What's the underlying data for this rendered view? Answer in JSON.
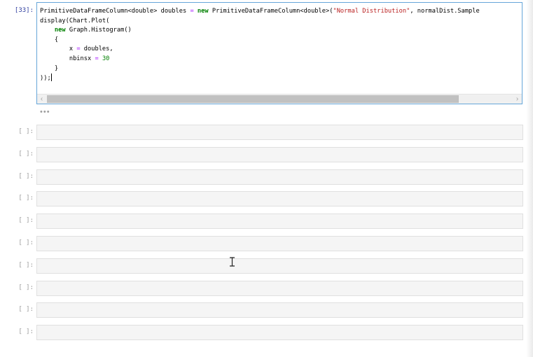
{
  "cells": {
    "active": {
      "prompt": "[33]:",
      "lines": [
        [
          {
            "t": "PrimitiveDataFrameColumn<double> doubles ",
            "c": ""
          },
          {
            "t": "=",
            "c": "op"
          },
          {
            "t": " ",
            "c": ""
          },
          {
            "t": "new",
            "c": "kw"
          },
          {
            "t": " PrimitiveDataFrameColumn<double>(",
            "c": ""
          },
          {
            "t": "\"Normal Distribution\"",
            "c": "str"
          },
          {
            "t": ", normalDist.Sample",
            "c": ""
          }
        ],
        [
          {
            "t": "display(Chart.Plot(",
            "c": ""
          }
        ],
        [
          {
            "t": "    ",
            "c": ""
          },
          {
            "t": "new",
            "c": "kw"
          },
          {
            "t": " Graph.Histogram()",
            "c": ""
          }
        ],
        [
          {
            "t": "    {",
            "c": ""
          }
        ],
        [
          {
            "t": "        x ",
            "c": ""
          },
          {
            "t": "=",
            "c": "op"
          },
          {
            "t": " doubles,",
            "c": ""
          }
        ],
        [
          {
            "t": "        nbinsx ",
            "c": ""
          },
          {
            "t": "=",
            "c": "op"
          },
          {
            "t": " ",
            "c": ""
          },
          {
            "t": "30",
            "c": "num"
          }
        ],
        [
          {
            "t": "    }",
            "c": ""
          }
        ],
        [
          {
            "t": "));",
            "c": ""
          }
        ]
      ]
    },
    "output_collapsed": "•••",
    "empty_prompt": "[ ]:",
    "empty_count": 10
  },
  "scrollbar": {
    "left_arrow": "‹",
    "right_arrow": "›"
  },
  "icons": {
    "cursor": "i-beam-cursor-icon"
  }
}
